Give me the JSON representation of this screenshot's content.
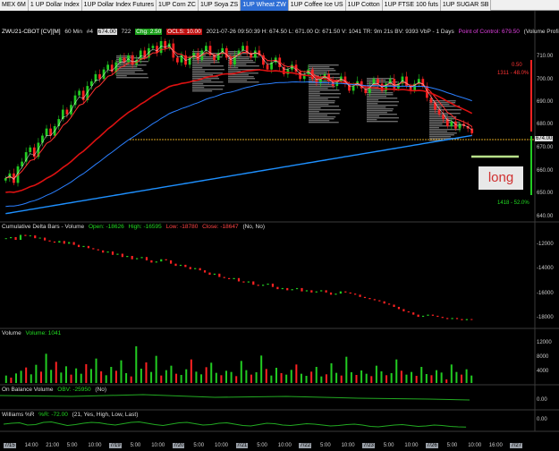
{
  "tabs": [
    "MEX 6M",
    "1 UP Dollar Index",
    "1UP Dollar Index Futures",
    "1UP Corn ZC",
    "1UP Soya ZS",
    "1UP Wheat ZW",
    "1UP Coffee Ice US",
    "1UP Cotton",
    "1UP FTSE 100 futs",
    "1UP SUGAR SB"
  ],
  "active_tab": "1UP Wheat ZW",
  "header": {
    "symbol": "ZWU21-CBOT [CV][M]",
    "interval": "60 Min",
    "num": "#4",
    "last_box": "674.00",
    "size": "722",
    "chg_box": "Chg: 2.50",
    "ocls_box": "OCLS: 10.00",
    "info": "2021-07-26 09:50:39 H: 674.50 L: 671.00 O: 671.50 V: 1041 TR: 9m 21s BV: 9393 VbP - 1 Days",
    "poc": "Point of Control: 679.50",
    "vp": "(Volume Profi"
  },
  "pane_titles": {
    "cdb": [
      "Cumulative Delta Bars - Volume",
      "Open: -18626",
      "High: -16595",
      "Low: -18780",
      "Close: -18647",
      "(No, No)"
    ],
    "vol": [
      "Volume",
      "Volume: 1041"
    ],
    "obv": [
      "On Balance Volume",
      "OBV: -25950",
      "(No)"
    ],
    "wr": [
      "Williams %R",
      "%R: -72.00",
      "(21, Yes, High, Low, Last)"
    ]
  },
  "price_ticks": [
    "710.00",
    "700.00",
    "690.00",
    "680.00",
    "670.00",
    "660.00",
    "650.00",
    "640.00"
  ],
  "cdb_ticks": [
    "-12000",
    "-14000",
    "-16000",
    "-18000"
  ],
  "vol_ticks": [
    "12000",
    "8000",
    "4000"
  ],
  "obv_ticks": [
    "0.00"
  ],
  "wr_ticks": [
    "0.00"
  ],
  "annotations": {
    "top_right": "1311 - 48.0%",
    "top_right_val": "0.50",
    "bottom_right": "1418 - 52.0%",
    "last_price_tag": "674.00",
    "long_label": "long"
  },
  "time_axis": [
    {
      "t": "7/15",
      "d": true
    },
    {
      "t": "14:00",
      "d": false
    },
    {
      "t": "21:00",
      "d": false
    },
    {
      "t": "5:00",
      "d": false
    },
    {
      "t": "10:00",
      "d": false
    },
    {
      "t": "7/19",
      "d": true
    },
    {
      "t": "5:00",
      "d": false
    },
    {
      "t": "10:00",
      "d": false
    },
    {
      "t": "7/20",
      "d": true
    },
    {
      "t": "5:00",
      "d": false
    },
    {
      "t": "10:00",
      "d": false
    },
    {
      "t": "7/21",
      "d": true
    },
    {
      "t": "5:00",
      "d": false
    },
    {
      "t": "10:00",
      "d": false
    },
    {
      "t": "7/22",
      "d": true
    },
    {
      "t": "5:00",
      "d": false
    },
    {
      "t": "10:00",
      "d": false
    },
    {
      "t": "7/23",
      "d": true
    },
    {
      "t": "5:00",
      "d": false
    },
    {
      "t": "10:00",
      "d": false
    },
    {
      "t": "7/26",
      "d": true
    },
    {
      "t": "5:00",
      "d": false
    },
    {
      "t": "10:00",
      "d": false
    },
    {
      "t": "16:00",
      "d": false
    },
    {
      "t": "7/27",
      "d": true
    }
  ],
  "colors": {
    "up": "#22cc22",
    "down": "#ff2222",
    "ema_fast": "#ff3030",
    "ema_mid": "#dd1111",
    "ema_slow": "#2a7fff",
    "ma_long": "#1e90ff",
    "wr": "#22aa22",
    "long_line": "#b8e08a"
  },
  "chart_data": {
    "type": "candlestick",
    "title": "ZWU21-CBOT [CV][M] 60 Min",
    "ylim": [
      638,
      716
    ],
    "closes": [
      655,
      657,
      653,
      660,
      662,
      666,
      668,
      664,
      670,
      673,
      676,
      673,
      677,
      680,
      684,
      682,
      686,
      690,
      692,
      688,
      694,
      696,
      699,
      697,
      701,
      703,
      700,
      704,
      706,
      704,
      707,
      703,
      705,
      709,
      706,
      710,
      711,
      708,
      713,
      710,
      712,
      706,
      704,
      707,
      703,
      706,
      708,
      705,
      709,
      711,
      707,
      705,
      708,
      710,
      706,
      703,
      707,
      709,
      711,
      708,
      706,
      709,
      707,
      703,
      701,
      704,
      706,
      702,
      699,
      701,
      703,
      700,
      697,
      699,
      701,
      697,
      695,
      697,
      699,
      696,
      694,
      696,
      698,
      695,
      692,
      694,
      696,
      693,
      691,
      694,
      697,
      695,
      692,
      695,
      697,
      693,
      695,
      698,
      694,
      692,
      695,
      697,
      694,
      689,
      687,
      684,
      682,
      680,
      677,
      679,
      676,
      678,
      677,
      676,
      674
    ],
    "cdb_ylim": [
      -19200,
      -10800
    ],
    "cdb": [
      -11300,
      -11200,
      -11450,
      -11000,
      -11100,
      -11050,
      -11300,
      -11250,
      -11500,
      -11600,
      -11700,
      -11550,
      -11800,
      -11650,
      -11900,
      -12100,
      -12000,
      -12200,
      -12300,
      -12400,
      -12600,
      -12500,
      -12800,
      -12700,
      -13000,
      -12900,
      -13200,
      -13100,
      -13000,
      -13300,
      -13500,
      -13400,
      -13200,
      -13300,
      -13600,
      -13800,
      -13700,
      -13900,
      -14100,
      -14000,
      -14200,
      -14400,
      -14600,
      -14500,
      -14800,
      -14900,
      -15000,
      -14900,
      -15200,
      -15300,
      -15200,
      -15500,
      -15600,
      -15500,
      -15400,
      -15700,
      -15900,
      -15800,
      -16000,
      -15900,
      -15800,
      -16100,
      -16000,
      -16200,
      -16100,
      -16000,
      -16200,
      -16400,
      -16300,
      -16100,
      -16200,
      -16300,
      -16400,
      -16600,
      -16700,
      -16800,
      -16900,
      -17000,
      -17200,
      -17300,
      -17500,
      -17700,
      -17900,
      -18000,
      -18200,
      -18400,
      -18300,
      -18200,
      -18300,
      -18400,
      -18500,
      -18600,
      -18500,
      -18600,
      -18700,
      -18600,
      -18650
    ],
    "vol_ylim": [
      0,
      15000
    ],
    "volume": [
      2500,
      1800,
      3200,
      4100,
      5200,
      2900,
      6100,
      3800,
      9800,
      4400,
      7100,
      3500,
      5600,
      2800,
      4900,
      3100,
      6300,
      4700,
      8200,
      3900,
      2600,
      5400,
      4100,
      7600,
      3300,
      2200,
      12300,
      4800,
      6900,
      3700,
      9100,
      2500,
      4300,
      5800,
      3100,
      2700,
      4600,
      7900,
      3800,
      2900,
      5300,
      6800,
      3400,
      2600,
      4100,
      3700,
      2300,
      7400,
      4300,
      2800,
      3600,
      9200,
      4700,
      2500,
      5100,
      3300,
      2800,
      4400,
      6200,
      3100,
      2400,
      3800,
      5400,
      2200,
      2900,
      6600,
      3400,
      2500,
      8800,
      3600,
      2700,
      4200,
      3100,
      2300,
      5800,
      3900,
      2600,
      3300,
      7900,
      4100,
      2800,
      3700,
      2400,
      5400,
      3000,
      2600,
      4300,
      3500,
      1200,
      6200,
      3700,
      2800,
      4600,
      2500
    ],
    "wr": [
      -40,
      -30,
      -25,
      -50,
      -45,
      -20,
      -15,
      -35,
      -55,
      -45,
      -30,
      -20,
      -25,
      -40,
      -50,
      -35,
      -20,
      -15,
      -30,
      -45,
      -55,
      -40,
      -25,
      -20,
      -35,
      -50,
      -45,
      -30,
      -25,
      -40,
      -55,
      -60,
      -45,
      -30,
      -35,
      -50,
      -55,
      -45,
      -35,
      -40,
      -50,
      -60,
      -55,
      -45,
      -40,
      -50,
      -65,
      -70,
      -60,
      -50,
      -45,
      -55,
      -65,
      -60,
      -50,
      -55,
      -65,
      -70,
      -72
    ]
  }
}
